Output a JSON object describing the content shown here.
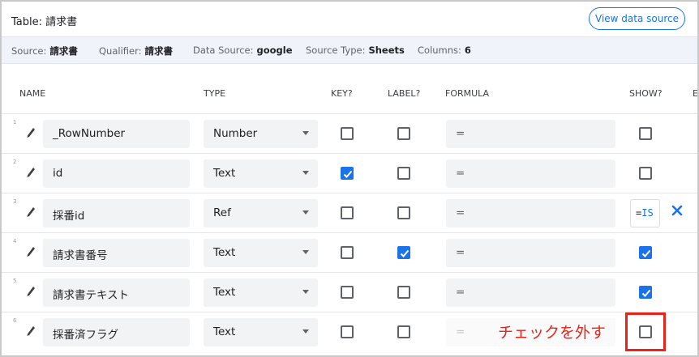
{
  "header": {
    "title": "Table: 請求書",
    "view_button": "View data source"
  },
  "info_bar": {
    "source_label": "Source:",
    "source_value": "請求書",
    "qualifier_label": "Qualifier:",
    "qualifier_value": "請求書",
    "datasource_label": "Data Source:",
    "datasource_value": "google",
    "sourcetype_label": "Source Type:",
    "sourcetype_value": "Sheets",
    "columns_label": "Columns:",
    "columns_value": "6"
  },
  "columns": {
    "name": "NAME",
    "type": "TYPE",
    "key": "KEY?",
    "label": "LABEL?",
    "formula": "FORMULA",
    "show": "SHOW?",
    "cut_off": "E"
  },
  "rows": [
    {
      "num": "1",
      "name": "_RowNumber",
      "type": "Number",
      "key": false,
      "label": false,
      "formula": "=",
      "show": false
    },
    {
      "num": "2",
      "name": "id",
      "type": "Text",
      "key": true,
      "label": false,
      "formula": "=",
      "show": false
    },
    {
      "num": "3",
      "name": "採番id",
      "type": "Ref",
      "key": false,
      "label": false,
      "formula": "=",
      "editing_eq": "=",
      "editing_fn": "IS"
    },
    {
      "num": "4",
      "name": "請求書番号",
      "type": "Text",
      "key": false,
      "label": true,
      "formula": "=",
      "show": true
    },
    {
      "num": "5",
      "name": "請求書テキスト",
      "type": "Text",
      "key": false,
      "label": false,
      "formula": "=",
      "show": true
    },
    {
      "num": "6",
      "name": "採番済フラグ",
      "type": "Text",
      "key": false,
      "label": false,
      "formula": "=",
      "show": false
    }
  ],
  "annotation": {
    "text": "チェックを外す",
    "color": "#e8231a"
  },
  "colors": {
    "accent": "#1a73e8",
    "field_bg": "#f1f3f4",
    "info_bar_bg": "#f0f3fa"
  }
}
